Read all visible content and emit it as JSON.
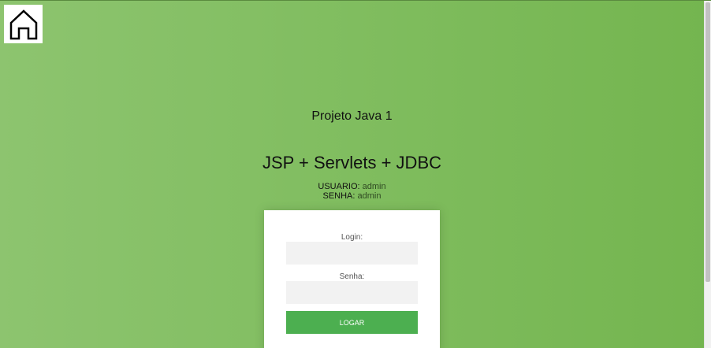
{
  "home": {
    "icon": "home-icon"
  },
  "header": {
    "title": "Projeto Java 1",
    "heading": "JSP + Servlets + JDBC"
  },
  "credentials": {
    "user_label": "USUARIO:",
    "user_value": "admin",
    "pass_label": "SENHA:",
    "pass_value": "admin"
  },
  "form": {
    "login_label": "Login:",
    "login_value": "",
    "password_label": "Senha:",
    "password_value": "",
    "submit_label": "LOGAR"
  },
  "colors": {
    "background": "#80bd5f",
    "button": "#4caf50",
    "input": "#f2f2f2",
    "card": "#ffffff"
  }
}
